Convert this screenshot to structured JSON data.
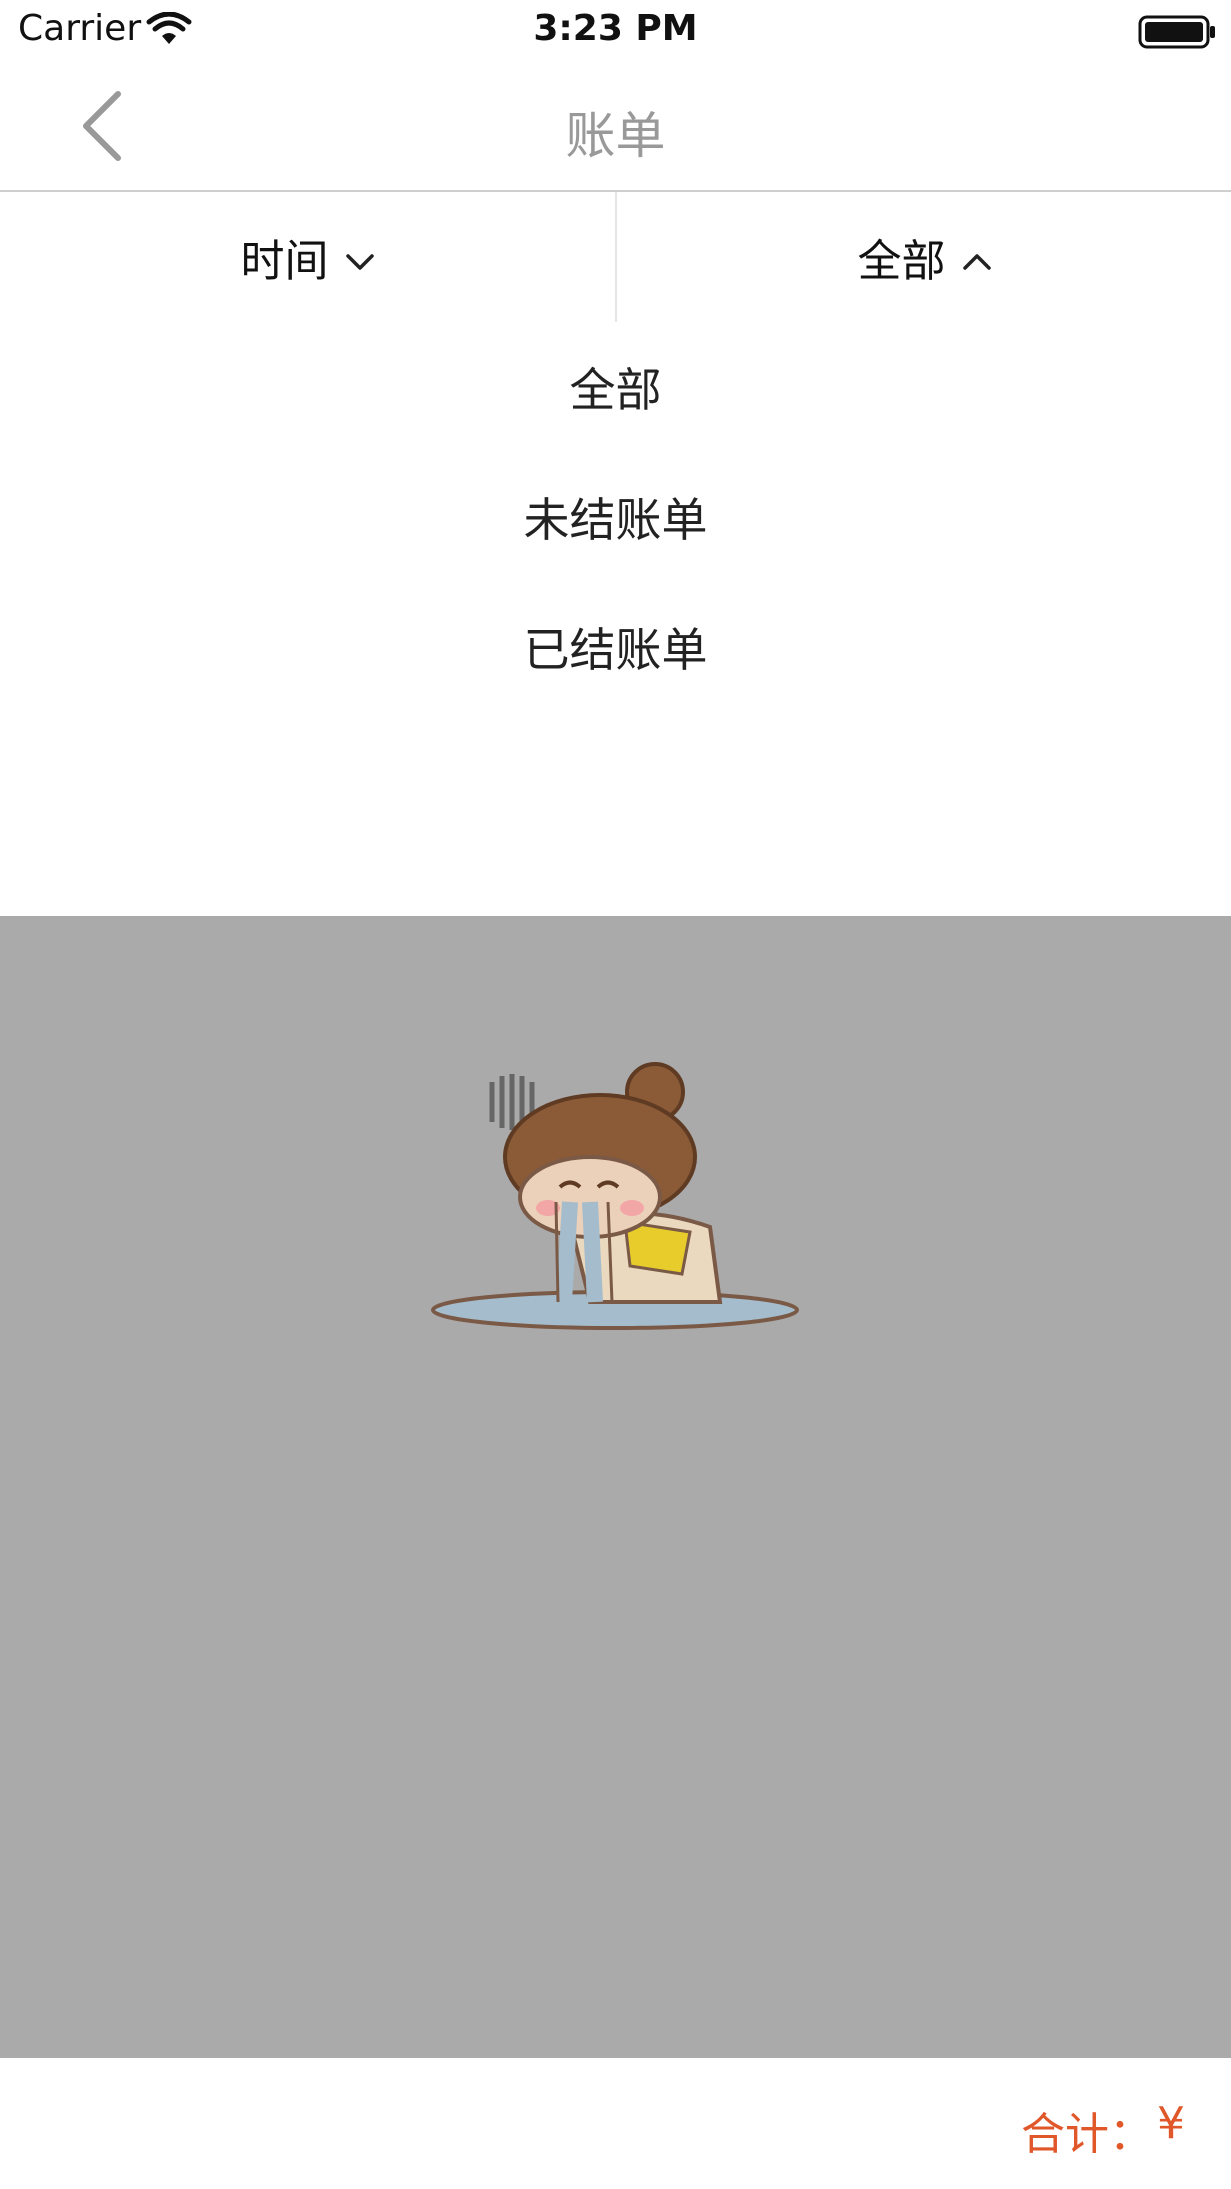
{
  "status_bar": {
    "carrier": "Carrier",
    "time": "3:23 PM"
  },
  "nav": {
    "title": "账单"
  },
  "filters": {
    "time_label": "时间",
    "status_label": "全部"
  },
  "dropdown": {
    "options": [
      "全部",
      "未结账单",
      "已结账单"
    ]
  },
  "footer": {
    "total_label": "合计：",
    "currency": "¥"
  },
  "colors": {
    "accent": "#e0572a",
    "overlay": "#aaaaaa",
    "title": "#999999"
  },
  "icons": {
    "back": "chevron-left-icon",
    "time_filter": "chevron-down-icon",
    "status_filter": "chevron-up-icon",
    "empty_state": "crying-girl-illustration"
  }
}
